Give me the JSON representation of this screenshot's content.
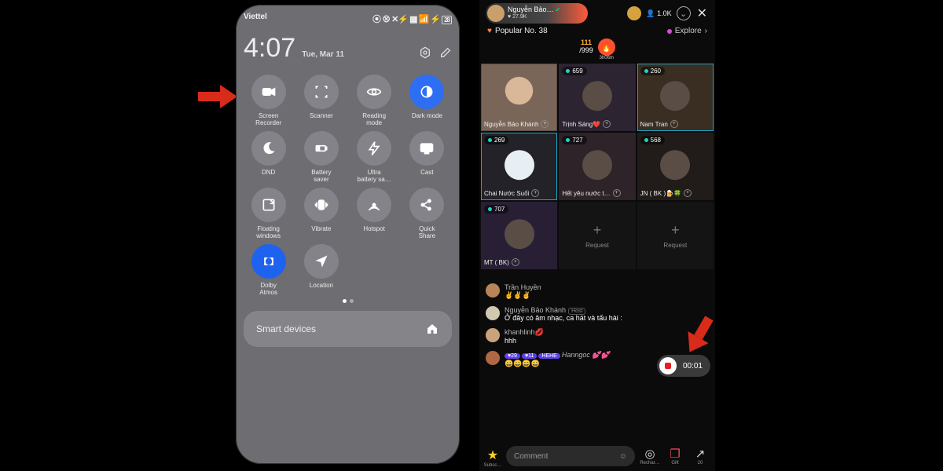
{
  "left": {
    "carrier": "Viettel",
    "status_icons": "⦿ ✈ ⧉ ▦ ∙∙∙∙ 📶 ⚡ 28",
    "time": "4:07",
    "date": "Tue, Mar 11",
    "tiles": [
      {
        "label": "Screen\nRecorder",
        "icon": "video"
      },
      {
        "label": "Scanner",
        "icon": "scan"
      },
      {
        "label": "Reading\nmode",
        "icon": "eye"
      },
      {
        "label": "Dark mode",
        "icon": "dark",
        "state": "active"
      },
      {
        "label": "DND",
        "icon": "moon"
      },
      {
        "label": "Battery\nsaver",
        "icon": "battery"
      },
      {
        "label": "Ultra\nbattery sa…",
        "icon": "bolt"
      },
      {
        "label": "Cast",
        "icon": "cast"
      },
      {
        "label": "Floating\nwindows",
        "icon": "float"
      },
      {
        "label": "Vibrate",
        "icon": "vibrate"
      },
      {
        "label": "Hotspot",
        "icon": "hotspot"
      },
      {
        "label": "Quick\nShare",
        "icon": "share"
      },
      {
        "label": "Dolby\nAtmos",
        "icon": "dolby",
        "state": "blue"
      },
      {
        "label": "Location",
        "icon": "location"
      }
    ],
    "smart_devices": "Smart devices"
  },
  "right": {
    "host_name": "Nguyễn Bảo…",
    "host_hearts": "♥ 27.9K",
    "viewers": "1.0K",
    "popular": "Popular No. 38",
    "explore": "Explore",
    "goal_top": "111",
    "goal_bottom": "/999",
    "gift_timer": "3h06m",
    "cells": [
      {
        "host": true,
        "name": "Nguyễn Bảo Khánh",
        "mic": true,
        "bg": "#5e4b46",
        "face": true
      },
      {
        "tag": "659",
        "name": "Trịnh Sáng❤️",
        "mic": true,
        "bg": "#2c2431"
      },
      {
        "tag": "260",
        "name": "Nam Tran",
        "mic": true,
        "bg": "#3a2e23",
        "hl": true
      },
      {
        "tag": "269",
        "name": "Chai Nước Suối",
        "mic": true,
        "bg": "#222228",
        "hl": true,
        "bottle": true
      },
      {
        "tag": "727",
        "name": "Hết yêu nước t…",
        "mic": true,
        "bg": "#2d2328"
      },
      {
        "tag": "568",
        "name": "JN ( BK )🍺🍀",
        "mic": true,
        "bg": "#211c1a"
      },
      {
        "tag": "707",
        "name": "MT ( BK)",
        "mic": true,
        "bg": "#281f35",
        "badge": true
      },
      {
        "empty": true,
        "req": "Request"
      },
      {
        "empty": true,
        "req": "Request"
      }
    ],
    "chat": [
      {
        "user": "Trần Huyền",
        "msg": "✌️✌️✌️",
        "av": "#b98458"
      },
      {
        "user": "Nguyễn Bảo Khánh",
        "host": true,
        "msg": "Ở đây có âm nhạc, ca hát và tấu hài :",
        "av": "#d1c8b0"
      },
      {
        "user": "khanhlinh💋",
        "msg": "hhh",
        "av": "#caa37c"
      },
      {
        "user": "",
        "badges": [
          "♥29",
          "♥11",
          "HEHE"
        ],
        "username": "Hanngoc 💕💕",
        "msg": "😄😄😄😄",
        "av": "#b06844"
      }
    ],
    "record_time": "00:01",
    "comment_placeholder": "Comment",
    "bottom": {
      "subscribe": "Subsc…",
      "recharge": "Rechar…",
      "gift": "Gift",
      "share": "20"
    }
  }
}
